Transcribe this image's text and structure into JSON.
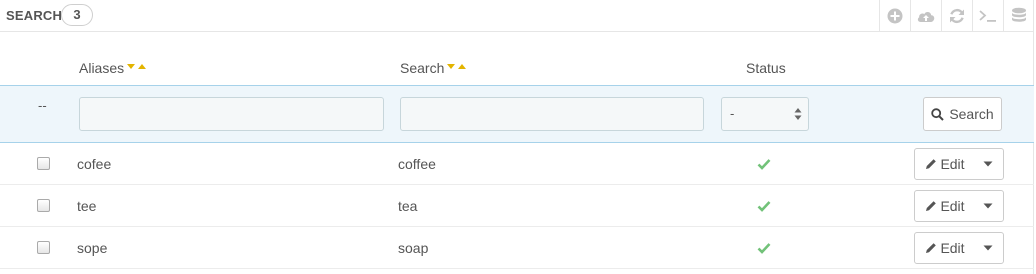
{
  "header": {
    "title": "SEARCH",
    "count": "3",
    "toolbar": [
      {
        "name": "add-new-icon"
      },
      {
        "name": "export-icon"
      },
      {
        "name": "refresh-icon"
      },
      {
        "name": "sql-query-icon"
      },
      {
        "name": "sql-manager-icon"
      }
    ]
  },
  "columns": {
    "aliases": "Aliases",
    "search": "Search",
    "status": "Status"
  },
  "filters": {
    "bulk_placeholder": "--",
    "aliases_value": "",
    "search_value": "",
    "status_selected": "-",
    "search_button": "Search"
  },
  "rows": [
    {
      "alias": "cofee",
      "search": "coffee",
      "status": "enabled",
      "edit_label": "Edit"
    },
    {
      "alias": "tee",
      "search": "tea",
      "status": "enabled",
      "edit_label": "Edit"
    },
    {
      "alias": "sope",
      "search": "soap",
      "status": "enabled",
      "edit_label": "Edit"
    }
  ],
  "colors": {
    "accent_sort": "#e3b400",
    "status_ok": "#72c279",
    "filter_bg": "#eef6fb",
    "filter_border": "#a6d2ea",
    "icon_gray": "#c4c4c4"
  }
}
